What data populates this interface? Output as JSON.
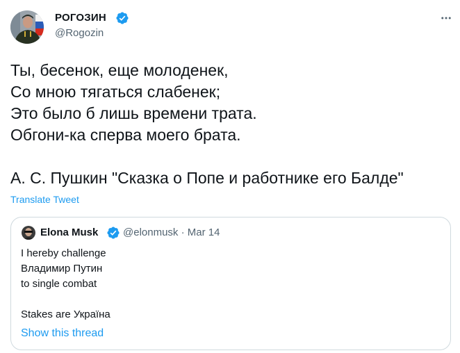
{
  "author": {
    "name": "РОГОЗИН",
    "handle": "@Rogozin",
    "verified": true,
    "avatar_icon": "profile-photo-icon"
  },
  "more_icon": "more-horizontal-icon",
  "tweet": {
    "lines": [
      "Ты, бесенок, еще молоденек,",
      "Со мною тягаться слабенек;",
      "Это было б лишь времени трата.",
      "Обгони-ка сперва моего брата.",
      "",
      "А. С. Пушкин \"Сказка о Попе и работнике его Балде\""
    ],
    "translate_label": "Translate Tweet"
  },
  "quoted": {
    "name": "Elona Musk",
    "handle": "@elonmusk",
    "separator": "·",
    "date": "Mar 14",
    "verified": true,
    "lines": [
      "I hereby challenge",
      "Владимир Путин",
      "to single combat",
      "",
      "Stakes are Україна"
    ],
    "show_thread_label": "Show this thread"
  },
  "colors": {
    "accent": "#1d9bf0",
    "text": "#0f1419",
    "secondary": "#536471",
    "border": "#cfd9de"
  }
}
